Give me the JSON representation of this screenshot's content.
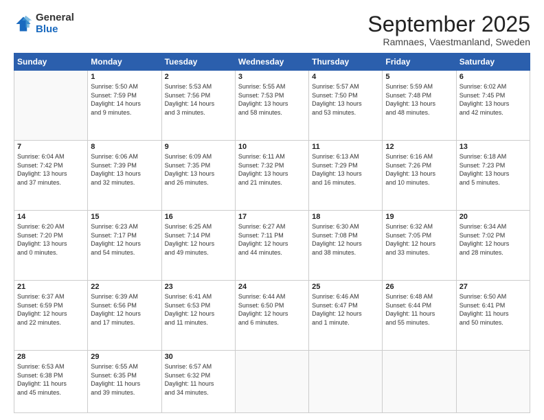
{
  "logo": {
    "general": "General",
    "blue": "Blue"
  },
  "header": {
    "title": "September 2025",
    "subtitle": "Ramnaes, Vaestmanland, Sweden"
  },
  "weekdays": [
    "Sunday",
    "Monday",
    "Tuesday",
    "Wednesday",
    "Thursday",
    "Friday",
    "Saturday"
  ],
  "weeks": [
    [
      {
        "day": "",
        "info": ""
      },
      {
        "day": "1",
        "info": "Sunrise: 5:50 AM\nSunset: 7:59 PM\nDaylight: 14 hours\nand 9 minutes."
      },
      {
        "day": "2",
        "info": "Sunrise: 5:53 AM\nSunset: 7:56 PM\nDaylight: 14 hours\nand 3 minutes."
      },
      {
        "day": "3",
        "info": "Sunrise: 5:55 AM\nSunset: 7:53 PM\nDaylight: 13 hours\nand 58 minutes."
      },
      {
        "day": "4",
        "info": "Sunrise: 5:57 AM\nSunset: 7:50 PM\nDaylight: 13 hours\nand 53 minutes."
      },
      {
        "day": "5",
        "info": "Sunrise: 5:59 AM\nSunset: 7:48 PM\nDaylight: 13 hours\nand 48 minutes."
      },
      {
        "day": "6",
        "info": "Sunrise: 6:02 AM\nSunset: 7:45 PM\nDaylight: 13 hours\nand 42 minutes."
      }
    ],
    [
      {
        "day": "7",
        "info": "Sunrise: 6:04 AM\nSunset: 7:42 PM\nDaylight: 13 hours\nand 37 minutes."
      },
      {
        "day": "8",
        "info": "Sunrise: 6:06 AM\nSunset: 7:39 PM\nDaylight: 13 hours\nand 32 minutes."
      },
      {
        "day": "9",
        "info": "Sunrise: 6:09 AM\nSunset: 7:35 PM\nDaylight: 13 hours\nand 26 minutes."
      },
      {
        "day": "10",
        "info": "Sunrise: 6:11 AM\nSunset: 7:32 PM\nDaylight: 13 hours\nand 21 minutes."
      },
      {
        "day": "11",
        "info": "Sunrise: 6:13 AM\nSunset: 7:29 PM\nDaylight: 13 hours\nand 16 minutes."
      },
      {
        "day": "12",
        "info": "Sunrise: 6:16 AM\nSunset: 7:26 PM\nDaylight: 13 hours\nand 10 minutes."
      },
      {
        "day": "13",
        "info": "Sunrise: 6:18 AM\nSunset: 7:23 PM\nDaylight: 13 hours\nand 5 minutes."
      }
    ],
    [
      {
        "day": "14",
        "info": "Sunrise: 6:20 AM\nSunset: 7:20 PM\nDaylight: 13 hours\nand 0 minutes."
      },
      {
        "day": "15",
        "info": "Sunrise: 6:23 AM\nSunset: 7:17 PM\nDaylight: 12 hours\nand 54 minutes."
      },
      {
        "day": "16",
        "info": "Sunrise: 6:25 AM\nSunset: 7:14 PM\nDaylight: 12 hours\nand 49 minutes."
      },
      {
        "day": "17",
        "info": "Sunrise: 6:27 AM\nSunset: 7:11 PM\nDaylight: 12 hours\nand 44 minutes."
      },
      {
        "day": "18",
        "info": "Sunrise: 6:30 AM\nSunset: 7:08 PM\nDaylight: 12 hours\nand 38 minutes."
      },
      {
        "day": "19",
        "info": "Sunrise: 6:32 AM\nSunset: 7:05 PM\nDaylight: 12 hours\nand 33 minutes."
      },
      {
        "day": "20",
        "info": "Sunrise: 6:34 AM\nSunset: 7:02 PM\nDaylight: 12 hours\nand 28 minutes."
      }
    ],
    [
      {
        "day": "21",
        "info": "Sunrise: 6:37 AM\nSunset: 6:59 PM\nDaylight: 12 hours\nand 22 minutes."
      },
      {
        "day": "22",
        "info": "Sunrise: 6:39 AM\nSunset: 6:56 PM\nDaylight: 12 hours\nand 17 minutes."
      },
      {
        "day": "23",
        "info": "Sunrise: 6:41 AM\nSunset: 6:53 PM\nDaylight: 12 hours\nand 11 minutes."
      },
      {
        "day": "24",
        "info": "Sunrise: 6:44 AM\nSunset: 6:50 PM\nDaylight: 12 hours\nand 6 minutes."
      },
      {
        "day": "25",
        "info": "Sunrise: 6:46 AM\nSunset: 6:47 PM\nDaylight: 12 hours\nand 1 minute."
      },
      {
        "day": "26",
        "info": "Sunrise: 6:48 AM\nSunset: 6:44 PM\nDaylight: 11 hours\nand 55 minutes."
      },
      {
        "day": "27",
        "info": "Sunrise: 6:50 AM\nSunset: 6:41 PM\nDaylight: 11 hours\nand 50 minutes."
      }
    ],
    [
      {
        "day": "28",
        "info": "Sunrise: 6:53 AM\nSunset: 6:38 PM\nDaylight: 11 hours\nand 45 minutes."
      },
      {
        "day": "29",
        "info": "Sunrise: 6:55 AM\nSunset: 6:35 PM\nDaylight: 11 hours\nand 39 minutes."
      },
      {
        "day": "30",
        "info": "Sunrise: 6:57 AM\nSunset: 6:32 PM\nDaylight: 11 hours\nand 34 minutes."
      },
      {
        "day": "",
        "info": ""
      },
      {
        "day": "",
        "info": ""
      },
      {
        "day": "",
        "info": ""
      },
      {
        "day": "",
        "info": ""
      }
    ]
  ]
}
